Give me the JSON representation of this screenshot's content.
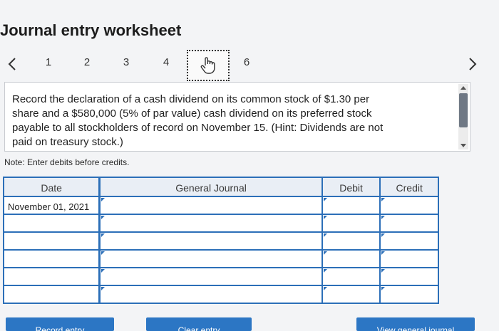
{
  "worksheet": {
    "title": "Journal entry worksheet"
  },
  "pagination": {
    "prev_icon": "chevron-left-icon",
    "next_icon": "chevron-right-icon",
    "pages": [
      "1",
      "2",
      "3",
      "4",
      "5",
      "6"
    ],
    "current_page": "5",
    "current_page_icon": "hand-pointer-icon"
  },
  "question": {
    "line1": "Record the declaration of a cash dividend on its common stock of $1.30 per",
    "line2": "share and a $580,000 (5% of par value) cash dividend on its preferred stock",
    "line3": "payable to all stockholders of record on November 15. (Hint: Dividends are not",
    "line4": "paid on treasury stock.)"
  },
  "note": {
    "text": "Note: Enter debits before credits."
  },
  "journal": {
    "columns": {
      "date": "Date",
      "general_journal": "General Journal",
      "debit": "Debit",
      "credit": "Credit"
    },
    "rows": [
      {
        "date": "November 01, 2021",
        "account": "",
        "debit": "",
        "credit": ""
      },
      {
        "date": "",
        "account": "",
        "debit": "",
        "credit": ""
      },
      {
        "date": "",
        "account": "",
        "debit": "",
        "credit": ""
      },
      {
        "date": "",
        "account": "",
        "debit": "",
        "credit": ""
      },
      {
        "date": "",
        "account": "",
        "debit": "",
        "credit": ""
      },
      {
        "date": "",
        "account": "",
        "debit": "",
        "credit": ""
      }
    ]
  },
  "buttons": {
    "record": "Record entry",
    "clear": "Clear entry",
    "view": "View general journal"
  },
  "colors": {
    "accent": "#2c6fb8",
    "button": "#2c76c4",
    "header_fill": "#e9eef5"
  }
}
